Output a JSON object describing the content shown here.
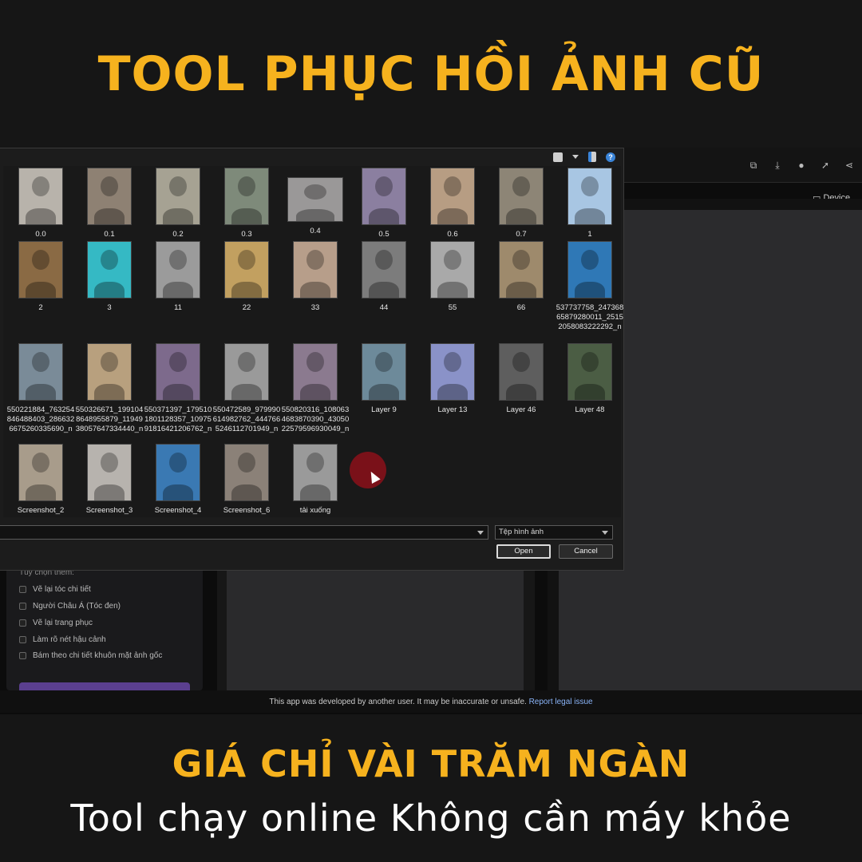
{
  "headline": "TOOL PHỤC HỒI ẢNH CŨ",
  "subheadline": "GIÁ CHỈ VÀI TRĂM NGÀN",
  "tagline": "Tool chạy online Không cần máy khỏe",
  "app": {
    "device_label": "Device",
    "options_label": "Tùy chọn thêm:",
    "options": [
      "Vẽ lại tóc chi tiết",
      "Người Châu Á (Tóc đen)",
      "Vẽ lại trang phục",
      "Làm rõ nét hậu cảnh",
      "Bám theo chi tiết khuôn mặt ảnh gốc"
    ],
    "footer_text": "This app was developed by another user. It may be inaccurate or unsafe.",
    "footer_link": "Report legal issue"
  },
  "dialog": {
    "files": [
      {
        "name": "0.0",
        "color": "#b8b3ab"
      },
      {
        "name": "0.1",
        "color": "#8e8173"
      },
      {
        "name": "0.2",
        "color": "#a6a293"
      },
      {
        "name": "0.3",
        "color": "#7e8a7a"
      },
      {
        "name": "0.4",
        "color": "#9a9898",
        "wide": true
      },
      {
        "name": "0.5",
        "color": "#8b7fa0"
      },
      {
        "name": "0.6",
        "color": "#b79d83"
      },
      {
        "name": "0.7",
        "color": "#8d8576"
      },
      {
        "name": "1",
        "color": "#a8c6e3"
      },
      {
        "name": "2",
        "color": "#8a6a44"
      },
      {
        "name": "3",
        "color": "#35b9c4"
      },
      {
        "name": "11",
        "color": "#9b9b9b"
      },
      {
        "name": "22",
        "color": "#c2a060"
      },
      {
        "name": "33",
        "color": "#b79e8a"
      },
      {
        "name": "44",
        "color": "#7c7c7c"
      },
      {
        "name": "55",
        "color": "#a9a9a9"
      },
      {
        "name": "66",
        "color": "#9e8a6c"
      },
      {
        "name": "537737758_24736865879280011_25152058083222292_n",
        "color": "#2f78b6"
      },
      {
        "name": "550221884_763254846488403_2866326675260335690_n",
        "color": "#7a8b98"
      },
      {
        "name": "550326671_1991048648955879_1194938057647334440_n",
        "color": "#b8a07e"
      },
      {
        "name": "550371397_1795101801128357_1097591816421206762_n",
        "color": "#7d6a8c"
      },
      {
        "name": "550472589_979990614982762_4447665246112701949_n",
        "color": "#9a9a9a"
      },
      {
        "name": "550820316_1080634683870390_4305022579596930049_n",
        "color": "#8b7a8f"
      },
      {
        "name": "Layer 9",
        "color": "#6d8a9a"
      },
      {
        "name": "Layer 13",
        "color": "#8a92c8"
      },
      {
        "name": "Layer 46",
        "color": "#5e5e5e"
      },
      {
        "name": "Layer 48",
        "color": "#4b5d44"
      },
      {
        "name": "Screenshot_2",
        "color": "#a89c8b"
      },
      {
        "name": "Screenshot_3",
        "color": "#b7b3ae"
      },
      {
        "name": "Screenshot_4",
        "color": "#3a79b3"
      },
      {
        "name": "Screenshot_6",
        "color": "#8b8178"
      },
      {
        "name": "tải xuống",
        "color": "#9a9a9a"
      }
    ],
    "file_type": "Tệp hình ảnh",
    "open_label": "Open",
    "cancel_label": "Cancel",
    "help_glyph": "?"
  }
}
